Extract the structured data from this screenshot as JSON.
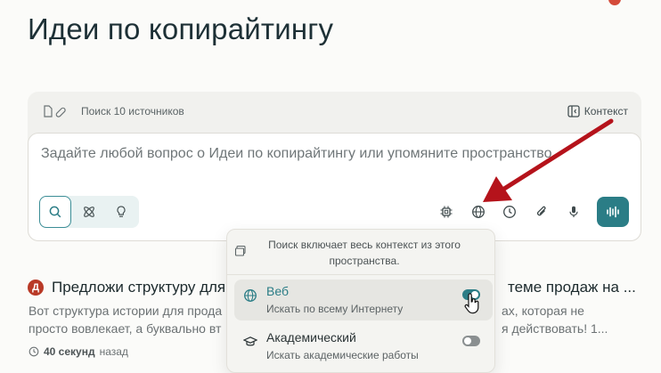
{
  "page": {
    "title": "Идеи по копирайтингу"
  },
  "composer": {
    "sources_label": "Поиск 10 источников",
    "context_label": "Контекст",
    "placeholder": "Задайте любой вопрос о Идеи по копирайтингу или упомяните пространство",
    "modes": [
      {
        "name": "search",
        "icon": "search-icon",
        "active": true
      },
      {
        "name": "research",
        "icon": "atom-icon",
        "active": false
      },
      {
        "name": "labs",
        "icon": "lightbulb-icon",
        "active": false
      }
    ],
    "tools": [
      "cpu-chip-icon",
      "globe-icon",
      "clock-icon",
      "paperclip-icon",
      "microphone-icon"
    ],
    "send_icon": "audio-wave-icon"
  },
  "thread": {
    "badge": "Д",
    "title": "Предложи структуру для и",
    "title_end": "теме продаж на ...",
    "snippet_line1": "Вот структура истории для прода",
    "snippet_line2": "просто вовлекает, а буквально вт",
    "snippet_right1": "ах, которая не",
    "snippet_right2": "я действовать! 1...",
    "time_value": "40 секунд",
    "time_suffix": "назад"
  },
  "popup": {
    "header": "Поиск включает весь контекст из этого пространства.",
    "options": [
      {
        "title": "Веб",
        "subtitle": "Искать по всему Интернету",
        "icon": "globe-icon",
        "enabled": true
      },
      {
        "title": "Академический",
        "subtitle": "Искать академические работы",
        "icon": "graduation-cap-icon",
        "enabled": false
      }
    ]
  },
  "colors": {
    "accent": "#2b7d86",
    "arrow": "#b5131b",
    "badge": "#b93a27"
  }
}
